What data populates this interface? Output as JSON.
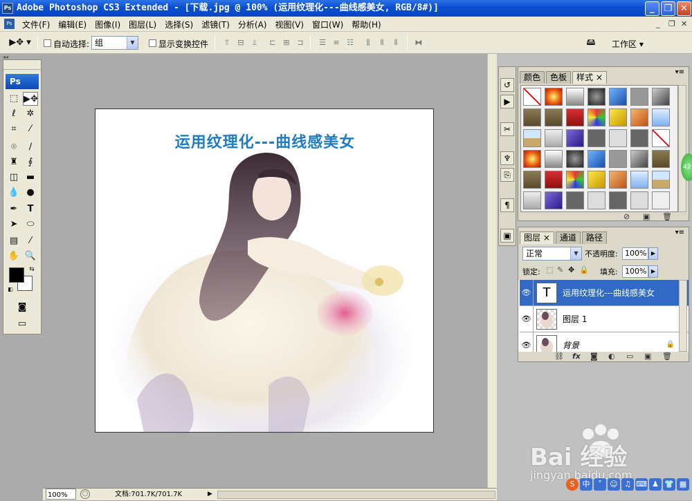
{
  "window": {
    "title": "Adobe Photoshop CS3 Extended - [下载.jpg @ 100% (运用纹理化---曲线感美女, RGB/8#)]",
    "app_icon": "Ps",
    "minimize": "_",
    "restore": "❐",
    "close": "✕"
  },
  "menu": {
    "doc_icon": "Ps",
    "items": [
      "文件(F)",
      "编辑(E)",
      "图像(I)",
      "图层(L)",
      "选择(S)",
      "滤镜(T)",
      "分析(A)",
      "视图(V)",
      "窗口(W)",
      "帮助(H)"
    ],
    "mdi_min": "_",
    "mdi_restore": "❐",
    "mdi_close": "✕"
  },
  "options": {
    "auto_select_label": "自动选择:",
    "auto_select_value": "组",
    "show_transform_label": "显示变换控件",
    "workspace_label": "工作区 ▾"
  },
  "toolbox": {
    "logo": "Ps"
  },
  "document": {
    "heading": "运用纹理化---曲线感美女"
  },
  "status": {
    "zoom": "100%",
    "doc_size": "文档:701.7K/701.7K"
  },
  "panels": {
    "styles_tabs": [
      "颜色",
      "色板",
      "样式 ×"
    ],
    "layers_tabs": [
      "图层 ×",
      "通道",
      "路径"
    ],
    "blend_mode": "正常",
    "opacity_label": "不透明度:",
    "opacity_value": "100%",
    "lock_label": "锁定:",
    "fill_label": "填充:",
    "fill_value": "100%",
    "layers": [
      {
        "name": "运用纹理化---曲线感美女",
        "thumb": "T"
      },
      {
        "name": "图层 1",
        "thumb": ""
      },
      {
        "name": "背景",
        "thumb": ""
      }
    ]
  },
  "watermark": {
    "brand": "Bai  经验",
    "url": "jingyan.baidu.com"
  },
  "bubble": "42"
}
